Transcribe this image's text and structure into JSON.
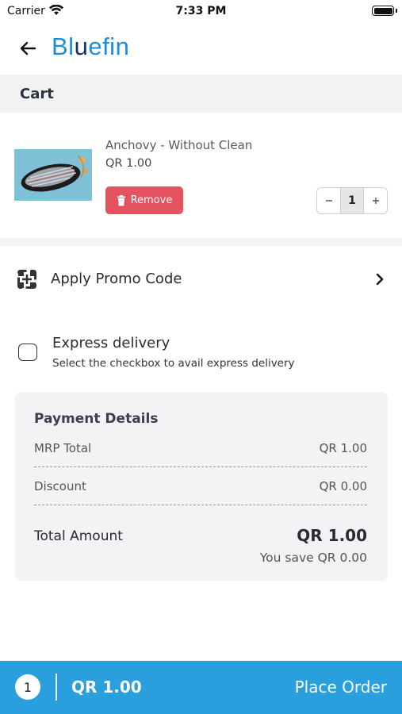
{
  "status_bar": {
    "carrier": "Carrier",
    "time": "7:33 PM"
  },
  "header": {
    "logo_text": "Bluefin",
    "back_icon": "arrow-left-icon"
  },
  "cart": {
    "title": "Cart",
    "items": [
      {
        "name": "Anchovy - Without Clean",
        "price": "QR 1.00",
        "quantity": "1",
        "remove_label": "Remove"
      }
    ]
  },
  "promo": {
    "label": "Apply Promo Code",
    "icon": "promo-icon"
  },
  "express": {
    "title": "Express delivery",
    "subtitle": "Select the checkbox to avail express delivery",
    "checked": false
  },
  "payment": {
    "title": "Payment Details",
    "rows": [
      {
        "label": "MRP Total",
        "value": "QR 1.00"
      },
      {
        "label": "Discount",
        "value": "QR 0.00"
      }
    ],
    "total_label": "Total Amount",
    "total_value": "QR 1.00",
    "savings": "You save QR 0.00"
  },
  "bottom_bar": {
    "count": "1",
    "total": "QR 1.00",
    "action_label": "Place Order"
  },
  "colors": {
    "accent": "#2a9fdd",
    "remove": "#e35460",
    "logo_blue": "#1f8fd1",
    "logo_dark": "#14346b"
  }
}
